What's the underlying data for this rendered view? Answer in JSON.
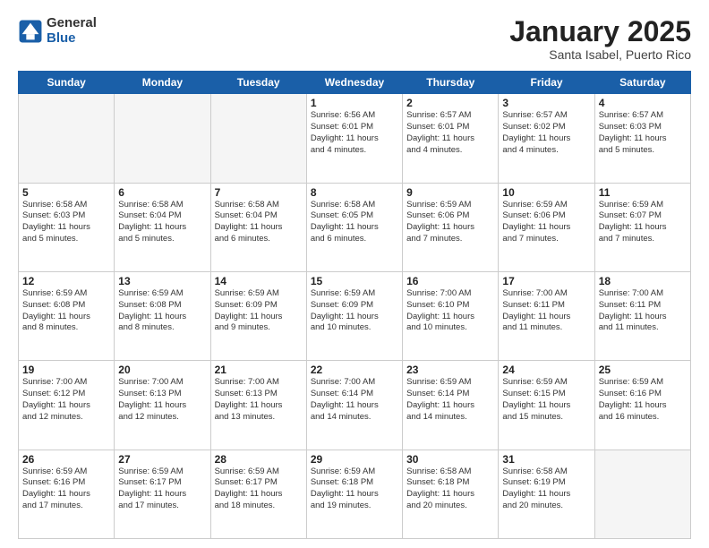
{
  "header": {
    "logo_general": "General",
    "logo_blue": "Blue",
    "title": "January 2025",
    "subtitle": "Santa Isabel, Puerto Rico"
  },
  "days_of_week": [
    "Sunday",
    "Monday",
    "Tuesday",
    "Wednesday",
    "Thursday",
    "Friday",
    "Saturday"
  ],
  "weeks": [
    [
      {
        "day": "",
        "info": ""
      },
      {
        "day": "",
        "info": ""
      },
      {
        "day": "",
        "info": ""
      },
      {
        "day": "1",
        "info": "Sunrise: 6:56 AM\nSunset: 6:01 PM\nDaylight: 11 hours\nand 4 minutes."
      },
      {
        "day": "2",
        "info": "Sunrise: 6:57 AM\nSunset: 6:01 PM\nDaylight: 11 hours\nand 4 minutes."
      },
      {
        "day": "3",
        "info": "Sunrise: 6:57 AM\nSunset: 6:02 PM\nDaylight: 11 hours\nand 4 minutes."
      },
      {
        "day": "4",
        "info": "Sunrise: 6:57 AM\nSunset: 6:03 PM\nDaylight: 11 hours\nand 5 minutes."
      }
    ],
    [
      {
        "day": "5",
        "info": "Sunrise: 6:58 AM\nSunset: 6:03 PM\nDaylight: 11 hours\nand 5 minutes."
      },
      {
        "day": "6",
        "info": "Sunrise: 6:58 AM\nSunset: 6:04 PM\nDaylight: 11 hours\nand 5 minutes."
      },
      {
        "day": "7",
        "info": "Sunrise: 6:58 AM\nSunset: 6:04 PM\nDaylight: 11 hours\nand 6 minutes."
      },
      {
        "day": "8",
        "info": "Sunrise: 6:58 AM\nSunset: 6:05 PM\nDaylight: 11 hours\nand 6 minutes."
      },
      {
        "day": "9",
        "info": "Sunrise: 6:59 AM\nSunset: 6:06 PM\nDaylight: 11 hours\nand 7 minutes."
      },
      {
        "day": "10",
        "info": "Sunrise: 6:59 AM\nSunset: 6:06 PM\nDaylight: 11 hours\nand 7 minutes."
      },
      {
        "day": "11",
        "info": "Sunrise: 6:59 AM\nSunset: 6:07 PM\nDaylight: 11 hours\nand 7 minutes."
      }
    ],
    [
      {
        "day": "12",
        "info": "Sunrise: 6:59 AM\nSunset: 6:08 PM\nDaylight: 11 hours\nand 8 minutes."
      },
      {
        "day": "13",
        "info": "Sunrise: 6:59 AM\nSunset: 6:08 PM\nDaylight: 11 hours\nand 8 minutes."
      },
      {
        "day": "14",
        "info": "Sunrise: 6:59 AM\nSunset: 6:09 PM\nDaylight: 11 hours\nand 9 minutes."
      },
      {
        "day": "15",
        "info": "Sunrise: 6:59 AM\nSunset: 6:09 PM\nDaylight: 11 hours\nand 10 minutes."
      },
      {
        "day": "16",
        "info": "Sunrise: 7:00 AM\nSunset: 6:10 PM\nDaylight: 11 hours\nand 10 minutes."
      },
      {
        "day": "17",
        "info": "Sunrise: 7:00 AM\nSunset: 6:11 PM\nDaylight: 11 hours\nand 11 minutes."
      },
      {
        "day": "18",
        "info": "Sunrise: 7:00 AM\nSunset: 6:11 PM\nDaylight: 11 hours\nand 11 minutes."
      }
    ],
    [
      {
        "day": "19",
        "info": "Sunrise: 7:00 AM\nSunset: 6:12 PM\nDaylight: 11 hours\nand 12 minutes."
      },
      {
        "day": "20",
        "info": "Sunrise: 7:00 AM\nSunset: 6:13 PM\nDaylight: 11 hours\nand 12 minutes."
      },
      {
        "day": "21",
        "info": "Sunrise: 7:00 AM\nSunset: 6:13 PM\nDaylight: 11 hours\nand 13 minutes."
      },
      {
        "day": "22",
        "info": "Sunrise: 7:00 AM\nSunset: 6:14 PM\nDaylight: 11 hours\nand 14 minutes."
      },
      {
        "day": "23",
        "info": "Sunrise: 6:59 AM\nSunset: 6:14 PM\nDaylight: 11 hours\nand 14 minutes."
      },
      {
        "day": "24",
        "info": "Sunrise: 6:59 AM\nSunset: 6:15 PM\nDaylight: 11 hours\nand 15 minutes."
      },
      {
        "day": "25",
        "info": "Sunrise: 6:59 AM\nSunset: 6:16 PM\nDaylight: 11 hours\nand 16 minutes."
      }
    ],
    [
      {
        "day": "26",
        "info": "Sunrise: 6:59 AM\nSunset: 6:16 PM\nDaylight: 11 hours\nand 17 minutes."
      },
      {
        "day": "27",
        "info": "Sunrise: 6:59 AM\nSunset: 6:17 PM\nDaylight: 11 hours\nand 17 minutes."
      },
      {
        "day": "28",
        "info": "Sunrise: 6:59 AM\nSunset: 6:17 PM\nDaylight: 11 hours\nand 18 minutes."
      },
      {
        "day": "29",
        "info": "Sunrise: 6:59 AM\nSunset: 6:18 PM\nDaylight: 11 hours\nand 19 minutes."
      },
      {
        "day": "30",
        "info": "Sunrise: 6:58 AM\nSunset: 6:18 PM\nDaylight: 11 hours\nand 20 minutes."
      },
      {
        "day": "31",
        "info": "Sunrise: 6:58 AM\nSunset: 6:19 PM\nDaylight: 11 hours\nand 20 minutes."
      },
      {
        "day": "",
        "info": ""
      }
    ]
  ]
}
